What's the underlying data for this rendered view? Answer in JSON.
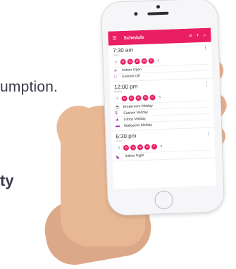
{
  "background": {
    "line1": "umption.",
    "line2": "ty"
  },
  "colors": {
    "accent": "#e91e63"
  },
  "app": {
    "title": "Schedule",
    "menu_icon": "menu-icon",
    "filter_icon": "filter-icon",
    "add_icon": "add-icon",
    "search_icon": "search-icon"
  },
  "schedules": [
    {
      "time": "7:30 am",
      "subtitle": "Open",
      "days": [
        {
          "label": "S",
          "on": false
        },
        {
          "label": "M",
          "on": true
        },
        {
          "label": "Tu",
          "on": true
        },
        {
          "label": "W",
          "on": true
        },
        {
          "label": "Th",
          "on": true
        },
        {
          "label": "F",
          "on": true
        },
        {
          "label": "S",
          "on": false
        }
      ],
      "items": [
        {
          "icon": "sun-icon",
          "label": "Indoor Open"
        },
        {
          "icon": "flag-icon",
          "label": "Exterior Off"
        }
      ]
    },
    {
      "time": "12:00 pm",
      "subtitle": "Midday",
      "days": [
        {
          "label": "S",
          "on": false
        },
        {
          "label": "M",
          "on": true
        },
        {
          "label": "Tu",
          "on": true
        },
        {
          "label": "W",
          "on": true
        },
        {
          "label": "Th",
          "on": true
        },
        {
          "label": "F",
          "on": true
        },
        {
          "label": "S",
          "on": false
        }
      ],
      "items": [
        {
          "icon": "breakroom-icon",
          "label": "Breakroom Midday"
        },
        {
          "icon": "dollar-icon",
          "label": "Cashier Midday"
        },
        {
          "icon": "lobby-icon",
          "label": "Lobby Midday"
        },
        {
          "icon": "wallpack-icon",
          "label": "Wallpacks Midday"
        }
      ]
    },
    {
      "time": "6:30 pm",
      "subtitle": "Close",
      "days": [
        {
          "label": "S",
          "on": false
        },
        {
          "label": "M",
          "on": true
        },
        {
          "label": "Tu",
          "on": true
        },
        {
          "label": "W",
          "on": true
        },
        {
          "label": "Th",
          "on": true
        },
        {
          "label": "F",
          "on": true
        },
        {
          "label": "S",
          "on": false
        }
      ],
      "items": [
        {
          "icon": "night-icon",
          "label": "Indoor Night"
        }
      ]
    }
  ]
}
